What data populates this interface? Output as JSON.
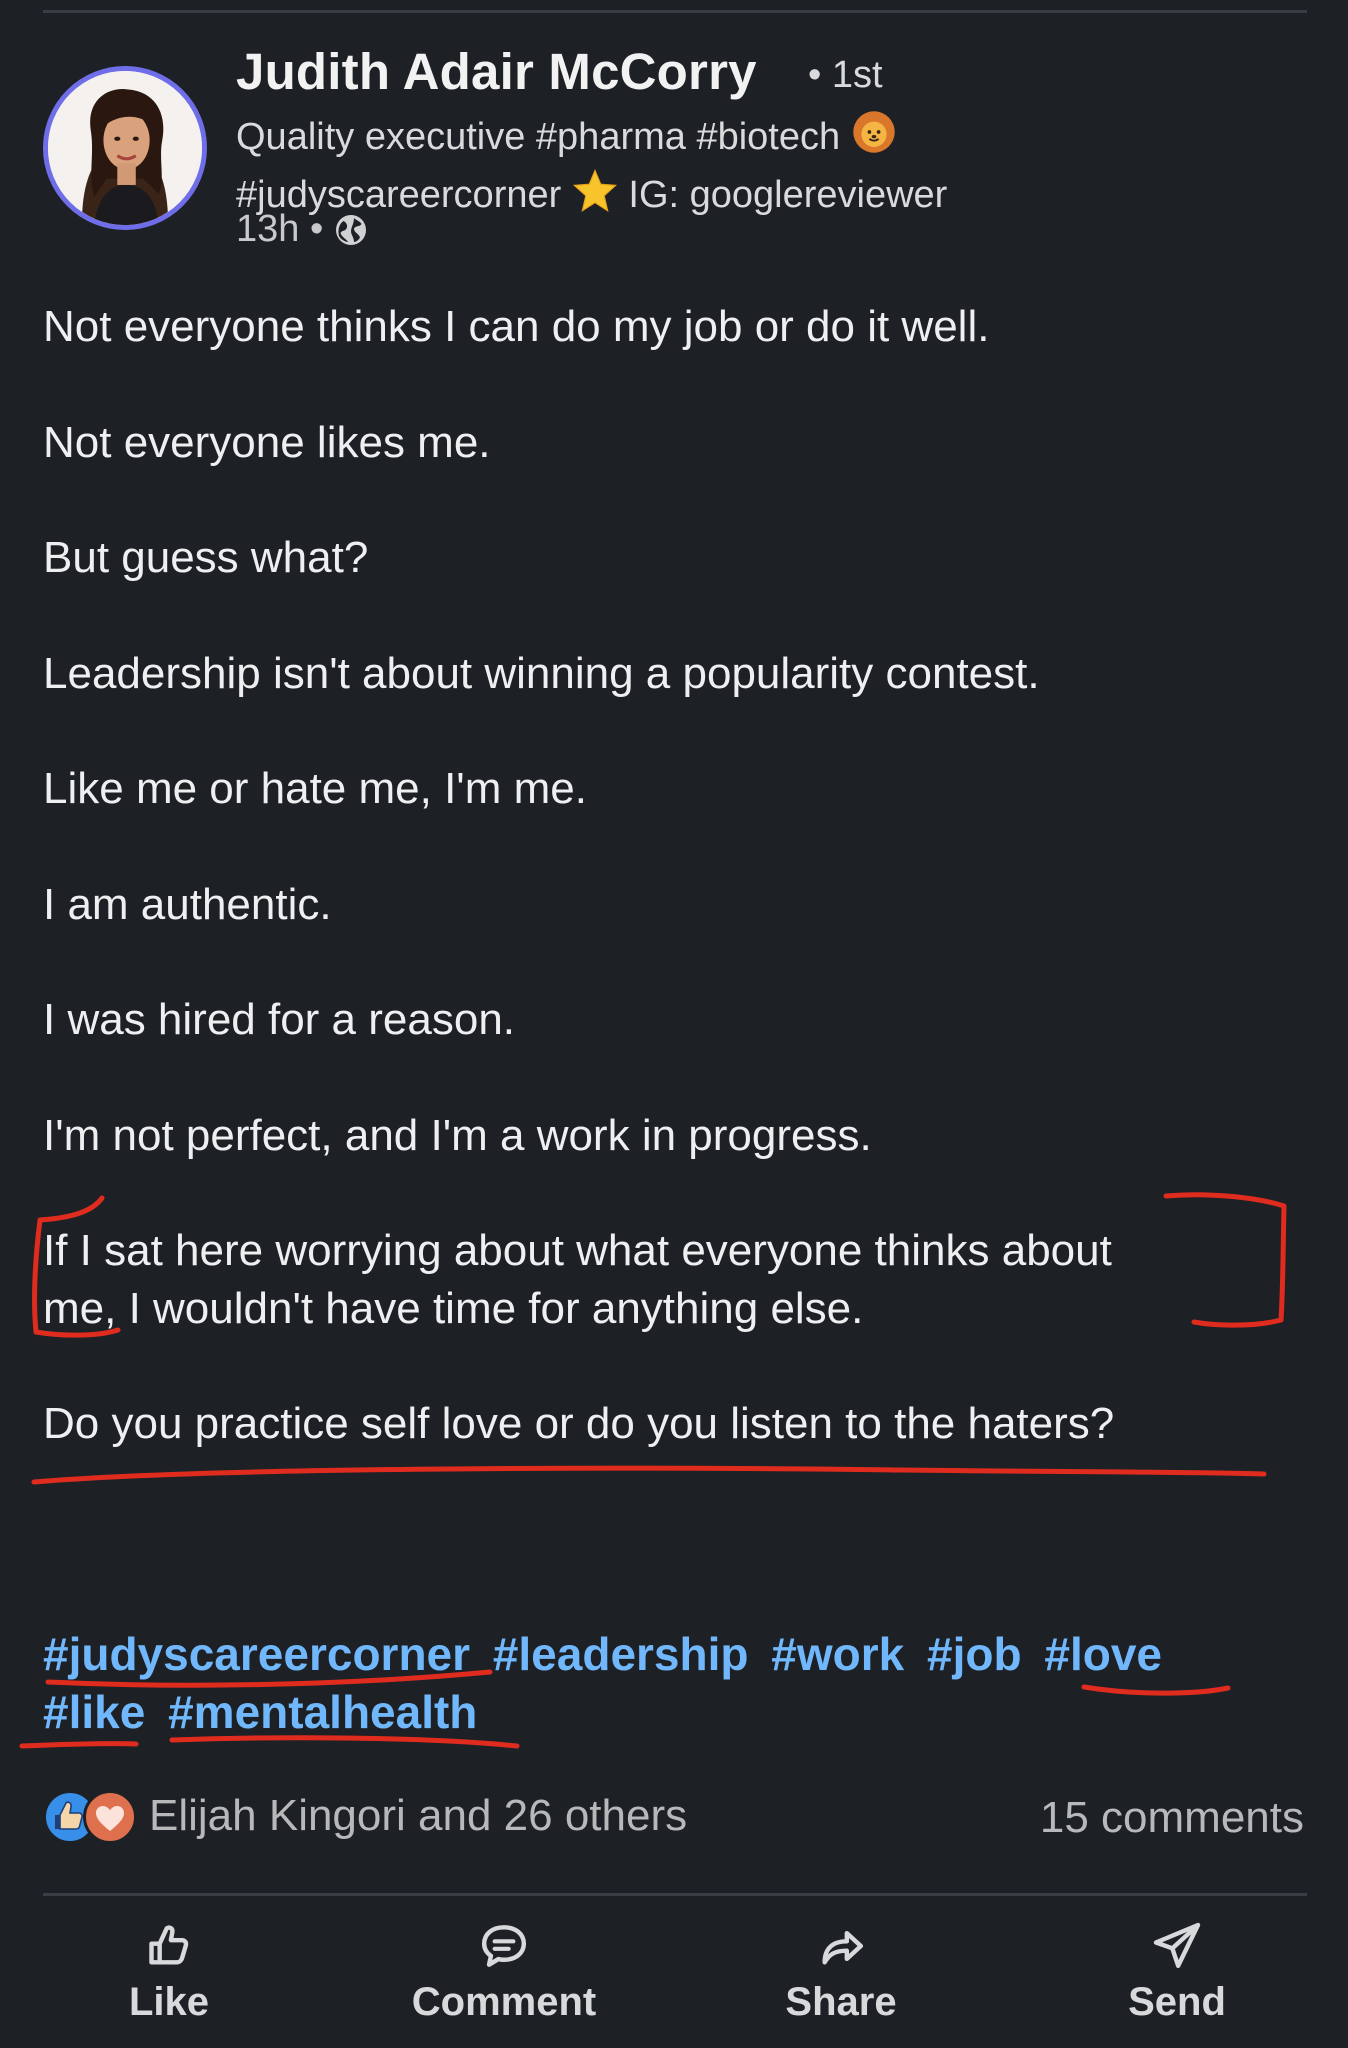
{
  "post": {
    "author": {
      "name": "Judith Adair McCorry",
      "degree": "• 1st",
      "headline_line1": "Quality executive #pharma #biotech",
      "headline_line2_a": "#judyscareercorner",
      "headline_line2_b": "IG: googlereviewer",
      "lion_emoji": "🦁",
      "star_emoji": "⭐",
      "timestamp": "13h •"
    },
    "paragraphs": [
      "Not everyone thinks I can do my job or do it well.",
      "Not everyone likes me.",
      "But guess what?",
      "Leadership isn't about winning a popularity contest.",
      "Like me or hate me, I'm me.",
      "I am authentic.",
      "I was hired for a reason.",
      "I'm not perfect, and I'm a work in progress.",
      "If I sat here worrying about what everyone thinks about",
      "me, I wouldn't have time for anything else.",
      "Do you practice self love or do you listen to the haters?"
    ],
    "hashtags": [
      "#judyscareercorner",
      "#leadership",
      "#work",
      "#job",
      "#love",
      "#like",
      "#mentalhealth"
    ],
    "reactions": {
      "text": "Elijah Kingori and 26 others",
      "comments": "15 comments"
    },
    "actions": {
      "like": "Like",
      "comment": "Comment",
      "share": "Share",
      "send": "Send"
    }
  },
  "colors": {
    "background": "#1d2025",
    "hashtag": "#71b7fb",
    "annotation": "#e02c1f",
    "avatar_ring": "#6f6ee8"
  },
  "icons": {
    "globe": "globe-icon",
    "like": "thumbs-up-icon",
    "comment": "comment-bubble-icon",
    "share": "share-arrow-icon",
    "send": "paper-plane-icon"
  }
}
